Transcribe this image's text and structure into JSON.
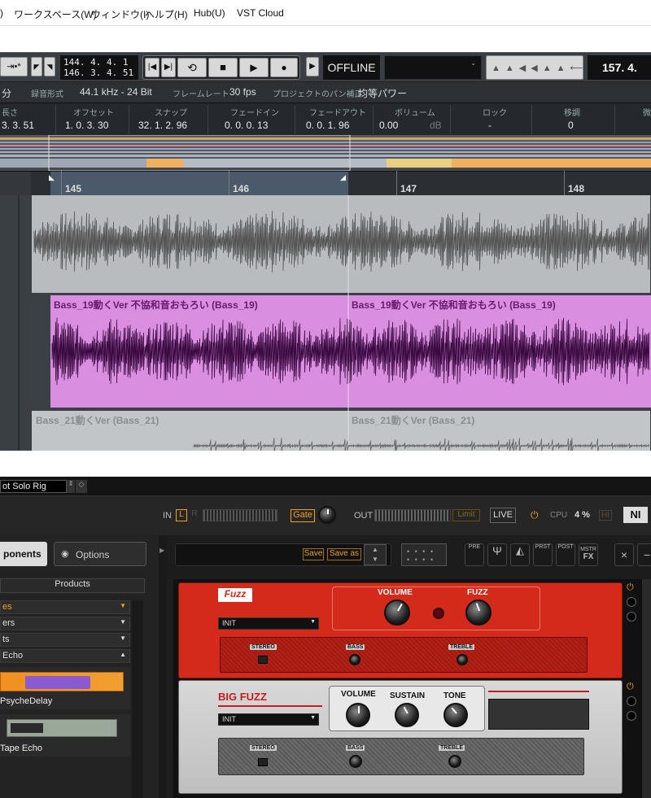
{
  "menu": {
    "items": [
      ")",
      "ワークスペース(W)",
      "ウィンドウ(I)",
      "ヘルプ(H)",
      "Hub(U)",
      "VST Cloud"
    ]
  },
  "transport": {
    "pos1": "144.  4.  4.   1",
    "pos2": "146.  3.  4.  51",
    "offline": "OFFLINE",
    "tempo": "157.  4."
  },
  "project": {
    "unit": "分",
    "rec_label": "録音形式",
    "rec_value": "44.1 kHz - 24 Bit",
    "fr_label": "フレームレート",
    "fr_value": "30 fps",
    "pan_label": "プロジェクトのパン補正",
    "pan_value": "均等パワー"
  },
  "info": {
    "headers": [
      "長さ",
      "オフセット",
      "スナップ",
      "フェードイン",
      "フェードアウト",
      "ボリューム",
      "ロック",
      "移調",
      "微"
    ],
    "values": [
      "3.  3.  51",
      "1.  0.  3.  30",
      "32.  1.  2.  96",
      "0.  0.  0.  13",
      "0.  0.  1.  96",
      "0.00",
      "dB",
      "-",
      "0"
    ]
  },
  "ruler": {
    "bars": [
      "145",
      "146",
      "147",
      "148"
    ]
  },
  "events": {
    "bass19a": "Bass_19動くVer  不協和音おもろい (Bass_19)",
    "bass19b": "Bass_19動くVer  不協和音おもろい (Bass_19)",
    "bass21a": "Bass_21動くVer (Bass_21)",
    "bass21b": "Bass_21動くVer (Bass_21)"
  },
  "rig": {
    "preset": "ot Solo Rig",
    "in": "IN",
    "l": "L",
    "r": "R",
    "gate": "Gate",
    "out": "OUT",
    "limit": "Limit",
    "live": "LIVE",
    "cpu": "CPU",
    "cpu_val": "4 %",
    "hi": "HI",
    "logo": "NI",
    "components": "ponents",
    "options": "Options",
    "products": "Products",
    "save": "Save",
    "save_as": "Save as",
    "tools": [
      "PRE",
      "",
      "",
      "PRST",
      "POST",
      "MSTR"
    ],
    "tools_sub": [
      "",
      "",
      "",
      "",
      "",
      "FX"
    ],
    "close": "×",
    "minus": "−",
    "cats": [
      "es",
      "ers",
      "ts",
      "Echo"
    ],
    "psyche": "PsycheDelay",
    "tape": "Tape Echo",
    "fuzz": {
      "name": "Fuzz",
      "volume": "VOLUME",
      "fuzz": "FUZZ",
      "preset": "INIT",
      "stereo": "STEREO",
      "bass": "BASS",
      "treble": "TREBLE"
    },
    "bigfuzz": {
      "name": "BIG FUZZ",
      "volume": "VOLUME",
      "sustain": "SUSTAIN",
      "tone": "TONE",
      "preset": "INIT",
      "stereo": "STEREO",
      "bass": "BASS",
      "treble": "TREBLE"
    }
  },
  "colors": {
    "fuzz_red": "#d42a1c",
    "bass_pink": "#d98ee0",
    "grey_event": "#b9bcbf",
    "accent_orange": "#f0a020"
  }
}
